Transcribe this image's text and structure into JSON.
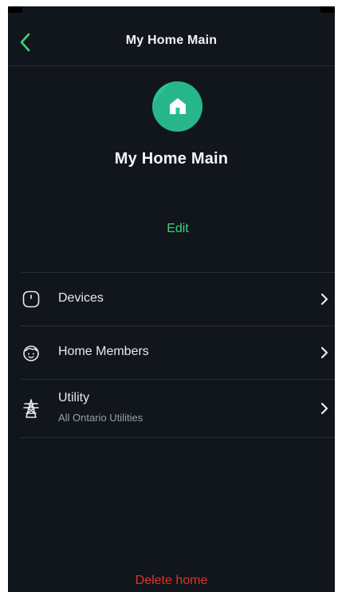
{
  "header": {
    "title": "My Home Main",
    "back_icon": "chevron-left-icon"
  },
  "home": {
    "name": "My Home Main",
    "icon": "home-icon",
    "icon_color": "#2bc394"
  },
  "edit_label": "Edit",
  "menu": [
    {
      "label": "Devices",
      "icon": "device-icon"
    },
    {
      "label": "Home Members",
      "icon": "members-icon"
    },
    {
      "label": "Utility",
      "sublabel": "All Ontario Utilities",
      "icon": "power-tower-icon"
    }
  ],
  "delete_label": "Delete home",
  "colors": {
    "background": "#11151c",
    "accent_green": "#3ed37a",
    "danger_red": "#e0312a"
  }
}
